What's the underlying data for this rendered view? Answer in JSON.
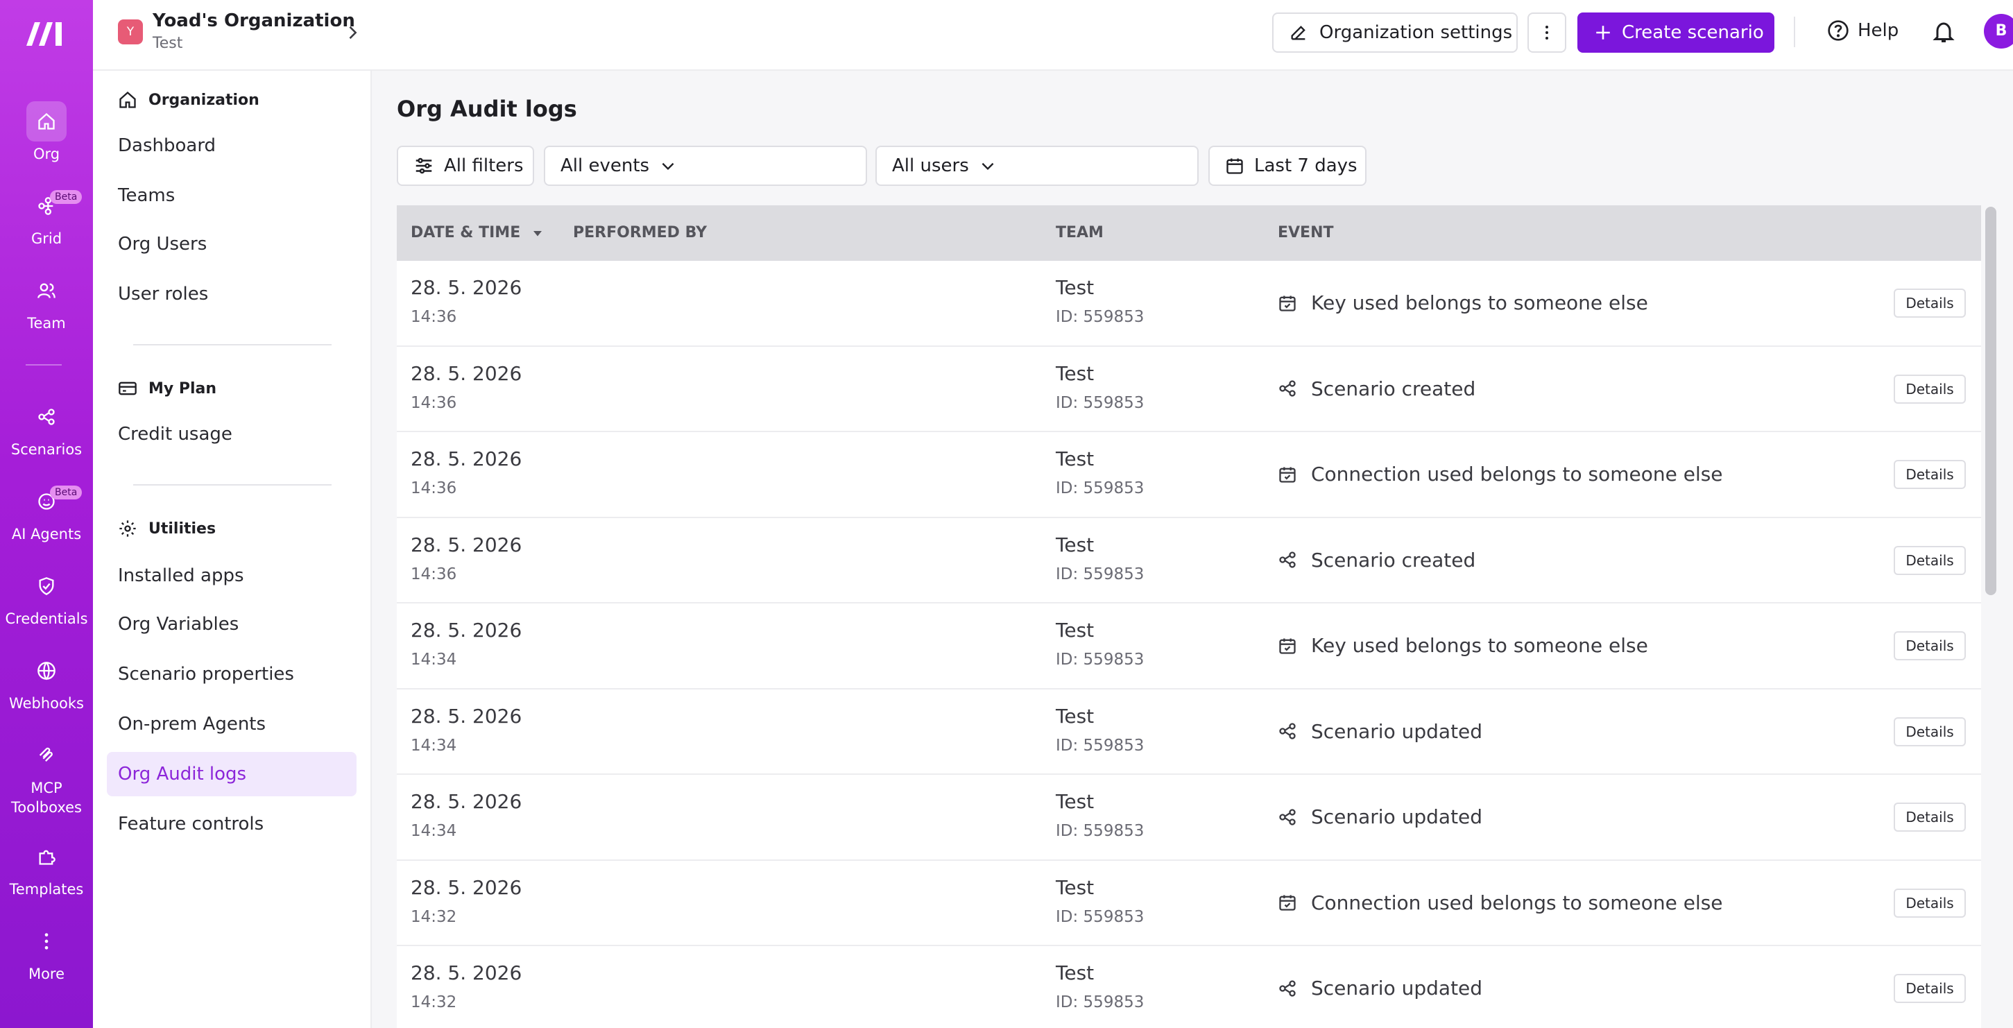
{
  "rail": {
    "items": [
      {
        "label": "Org",
        "icon": "home-icon",
        "active": true
      },
      {
        "label": "Grid",
        "icon": "grid-icon",
        "badge": "Beta"
      },
      {
        "label": "Team",
        "icon": "users-icon"
      },
      {
        "label": "Scenarios",
        "icon": "share-icon"
      },
      {
        "label": "AI Agents",
        "icon": "ai-agent-icon",
        "badge": "Beta"
      },
      {
        "label": "Credentials",
        "icon": "shield-icon"
      },
      {
        "label": "Webhooks",
        "icon": "globe-icon"
      },
      {
        "label": "MCP Toolboxes",
        "icon": "mcp-icon"
      },
      {
        "label": "Templates",
        "icon": "puzzle-icon"
      },
      {
        "label": "More",
        "icon": "dots-vertical-icon"
      }
    ]
  },
  "header": {
    "org_initial": "Y",
    "org_name": "Yoad's Organization",
    "org_sub": "Test",
    "org_settings_label": "Organization settings",
    "create_label": "Create scenario",
    "help_label": "Help",
    "avatar_initial": "B",
    "accent": "#7b16dc"
  },
  "sidebar": {
    "sections": [
      {
        "title": "Organization",
        "items": [
          "Dashboard",
          "Teams",
          "Org Users",
          "User roles"
        ]
      },
      {
        "title": "My Plan",
        "items": [
          "Credit usage"
        ]
      },
      {
        "title": "Utilities",
        "items": [
          "Installed apps",
          "Org Variables",
          "Scenario properties",
          "On-prem Agents",
          "Org Audit logs",
          "Feature controls"
        ]
      }
    ],
    "active_item": "Org Audit logs"
  },
  "main": {
    "title": "Org Audit logs",
    "filters": {
      "all_filters": "All filters",
      "events": "All events",
      "users": "All users",
      "range": "Last 7 days"
    },
    "columns": [
      "DATE & TIME",
      "PERFORMED BY",
      "TEAM",
      "EVENT"
    ],
    "details_label": "Details",
    "rows": [
      {
        "date": "28. 5. 2026",
        "time": "14:36",
        "team": "Test",
        "team_id": "ID: 559853",
        "event": "Key used belongs to someone else",
        "event_icon": "calendar-check-icon"
      },
      {
        "date": "28. 5. 2026",
        "time": "14:36",
        "team": "Test",
        "team_id": "ID: 559853",
        "event": "Scenario created",
        "event_icon": "share-icon"
      },
      {
        "date": "28. 5. 2026",
        "time": "14:36",
        "team": "Test",
        "team_id": "ID: 559853",
        "event": "Connection used belongs to someone else",
        "event_icon": "calendar-check-icon"
      },
      {
        "date": "28. 5. 2026",
        "time": "14:36",
        "team": "Test",
        "team_id": "ID: 559853",
        "event": "Scenario created",
        "event_icon": "share-icon"
      },
      {
        "date": "28. 5. 2026",
        "time": "14:34",
        "team": "Test",
        "team_id": "ID: 559853",
        "event": "Key used belongs to someone else",
        "event_icon": "calendar-check-icon"
      },
      {
        "date": "28. 5. 2026",
        "time": "14:34",
        "team": "Test",
        "team_id": "ID: 559853",
        "event": "Scenario updated",
        "event_icon": "share-icon"
      },
      {
        "date": "28. 5. 2026",
        "time": "14:34",
        "team": "Test",
        "team_id": "ID: 559853",
        "event": "Scenario updated",
        "event_icon": "share-icon"
      },
      {
        "date": "28. 5. 2026",
        "time": "14:32",
        "team": "Test",
        "team_id": "ID: 559853",
        "event": "Connection used belongs to someone else",
        "event_icon": "calendar-check-icon"
      },
      {
        "date": "28. 5. 2026",
        "time": "14:32",
        "team": "Test",
        "team_id": "ID: 559853",
        "event": "Scenario updated",
        "event_icon": "share-icon"
      }
    ]
  }
}
